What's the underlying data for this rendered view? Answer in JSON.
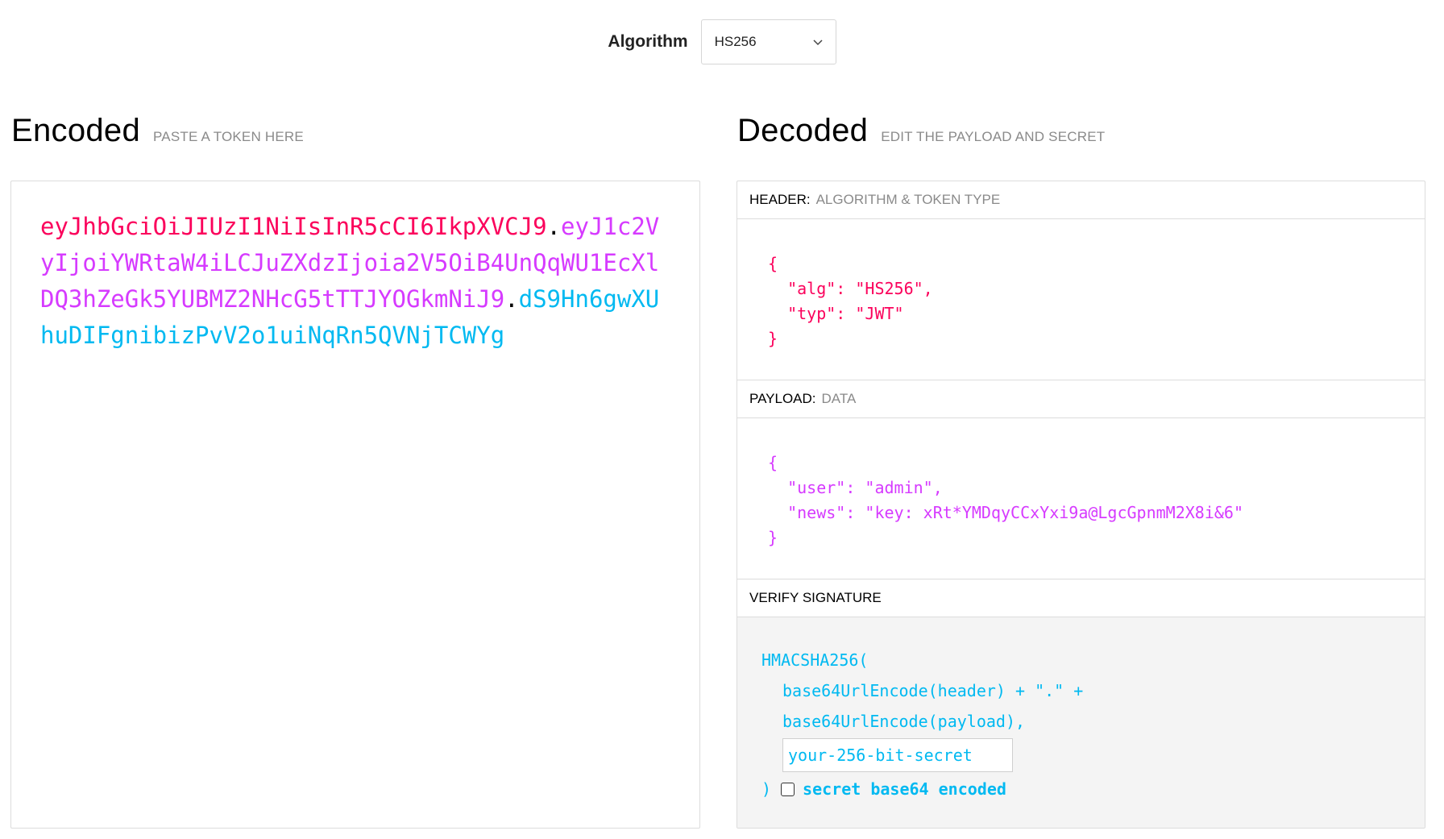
{
  "algorithm": {
    "label": "Algorithm",
    "selected": "HS256"
  },
  "encoded": {
    "title": "Encoded",
    "subtitle": "PASTE A TOKEN HERE",
    "token": {
      "header": "eyJhbGciOiJIUzI1NiIsInR5cCI6IkpXVCJ9",
      "dot1": ".",
      "payload": "eyJ1c2VyIjoiYWRtaW4iLCJuZXdzIjoia2V5OiB4UnQqWU1EcXlDQ3hZeGk5YUBMZ2NHcG5tTTJYOGkmNiJ9",
      "dot2": ".",
      "signature": "dS9Hn6gwXUhuDIFgnibizPvV2o1uiNqRn5QVNjTCWYg"
    }
  },
  "decoded": {
    "title": "Decoded",
    "subtitle": "EDIT THE PAYLOAD AND SECRET",
    "header_section": {
      "label": "HEADER:",
      "sub": "ALGORITHM & TOKEN TYPE",
      "json": "{\n  \"alg\": \"HS256\",\n  \"typ\": \"JWT\"\n}"
    },
    "payload_section": {
      "label": "PAYLOAD:",
      "sub": "DATA",
      "json": "{\n  \"user\": \"admin\",\n  \"news\": \"key: xRt*YMDqyCCxYxi9a@LgcGpnmM2X8i&6\"\n}"
    },
    "verify_section": {
      "label": "VERIFY SIGNATURE",
      "line1": "HMACSHA256(",
      "line2": "base64UrlEncode(header) + \".\" +",
      "line3": "base64UrlEncode(payload),",
      "secret_placeholder": "your-256-bit-secret",
      "close_paren": ")",
      "b64_label": "secret base64 encoded"
    }
  },
  "colors": {
    "header": "#fb015b",
    "payload": "#d63aff",
    "signature": "#00b9f1"
  }
}
